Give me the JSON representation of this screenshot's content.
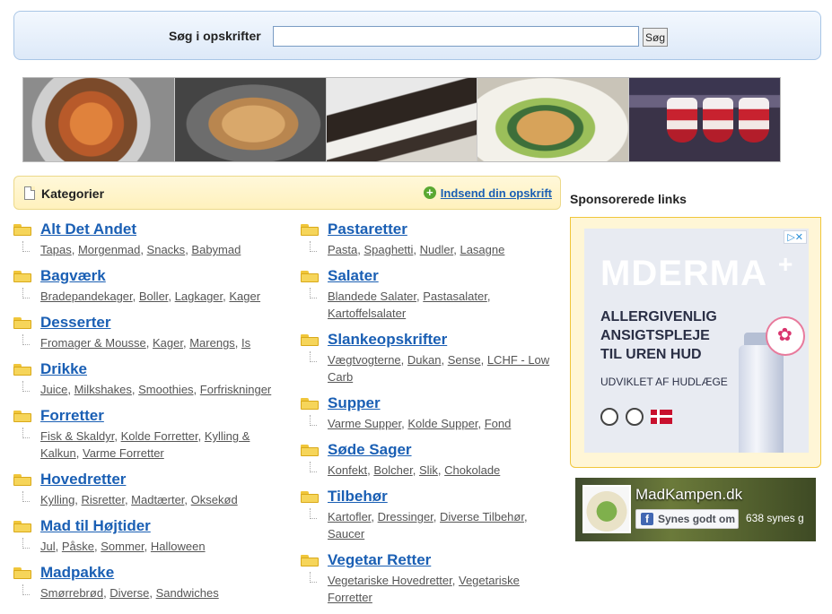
{
  "search": {
    "label": "Søg i opskrifter",
    "placeholder": "",
    "button_label": "Søg"
  },
  "categories_header": {
    "title": "Kategorier",
    "submit_label": "Indsend din opskrift"
  },
  "categories_left": [
    {
      "name": "Alt Det Andet",
      "subs": [
        "Tapas",
        "Morgenmad",
        "Snacks",
        "Babymad"
      ]
    },
    {
      "name": "Bagværk",
      "subs": [
        "Bradepandekager",
        "Boller",
        "Lagkager",
        "Kager"
      ]
    },
    {
      "name": "Desserter",
      "subs": [
        "Fromager & Mousse",
        "Kager",
        "Marengs",
        "Is"
      ]
    },
    {
      "name": "Drikke",
      "subs": [
        "Juice",
        "Milkshakes",
        "Smoothies",
        "Forfriskninger"
      ]
    },
    {
      "name": "Forretter",
      "subs": [
        "Fisk & Skaldyr",
        "Kolde Forretter",
        "Kylling & Kalkun",
        "Varme Forretter"
      ]
    },
    {
      "name": "Hovedretter",
      "subs": [
        "Kylling",
        "Risretter",
        "Madtærter",
        "Oksekød"
      ]
    },
    {
      "name": "Mad til Højtider",
      "subs": [
        "Jul",
        "Påske",
        "Sommer",
        "Halloween"
      ]
    },
    {
      "name": "Madpakke",
      "subs": [
        "Smørrebrød",
        "Diverse",
        "Sandwiches"
      ]
    }
  ],
  "categories_right": [
    {
      "name": "Pastaretter",
      "subs": [
        "Pasta",
        "Spaghetti",
        "Nudler",
        "Lasagne"
      ]
    },
    {
      "name": "Salater",
      "subs": [
        "Blandede Salater",
        "Pastasalater",
        "Kartoffelsalater"
      ]
    },
    {
      "name": "Slankeopskrifter",
      "subs": [
        "Vægtvogterne",
        "Dukan",
        "Sense",
        "LCHF - Low Carb"
      ]
    },
    {
      "name": "Supper",
      "subs": [
        "Varme Supper",
        "Kolde Supper",
        "Fond"
      ]
    },
    {
      "name": "Søde Sager",
      "subs": [
        "Konfekt",
        "Bolcher",
        "Slik",
        "Chokolade"
      ]
    },
    {
      "name": "Tilbehør",
      "subs": [
        "Kartofler",
        "Dressinger",
        "Diverse Tilbehør",
        "Saucer"
      ]
    },
    {
      "name": "Vegetar Retter",
      "subs": [
        "Vegetariske Hovedretter",
        "Vegetariske Forretter"
      ]
    }
  ],
  "sponsored": {
    "title": "Sponsorerede links",
    "ad": {
      "brand": "MDERMA",
      "headline": "ALLERGIVENLIG\nANSIGTSPLEJE\nTIL UREN HUD",
      "subline": "UDVIKLET AF HUDLÆGE",
      "choices_label": "▷✕"
    }
  },
  "facebook": {
    "page_name": "MadKampen.dk",
    "like_label": "Synes godt om",
    "like_count": "638 synes g"
  },
  "colors": {
    "link": "#1a5fb4",
    "search_bg": "#dde9f8",
    "category_header_bg": "#fff1bd",
    "folder": "#f6d55a"
  }
}
